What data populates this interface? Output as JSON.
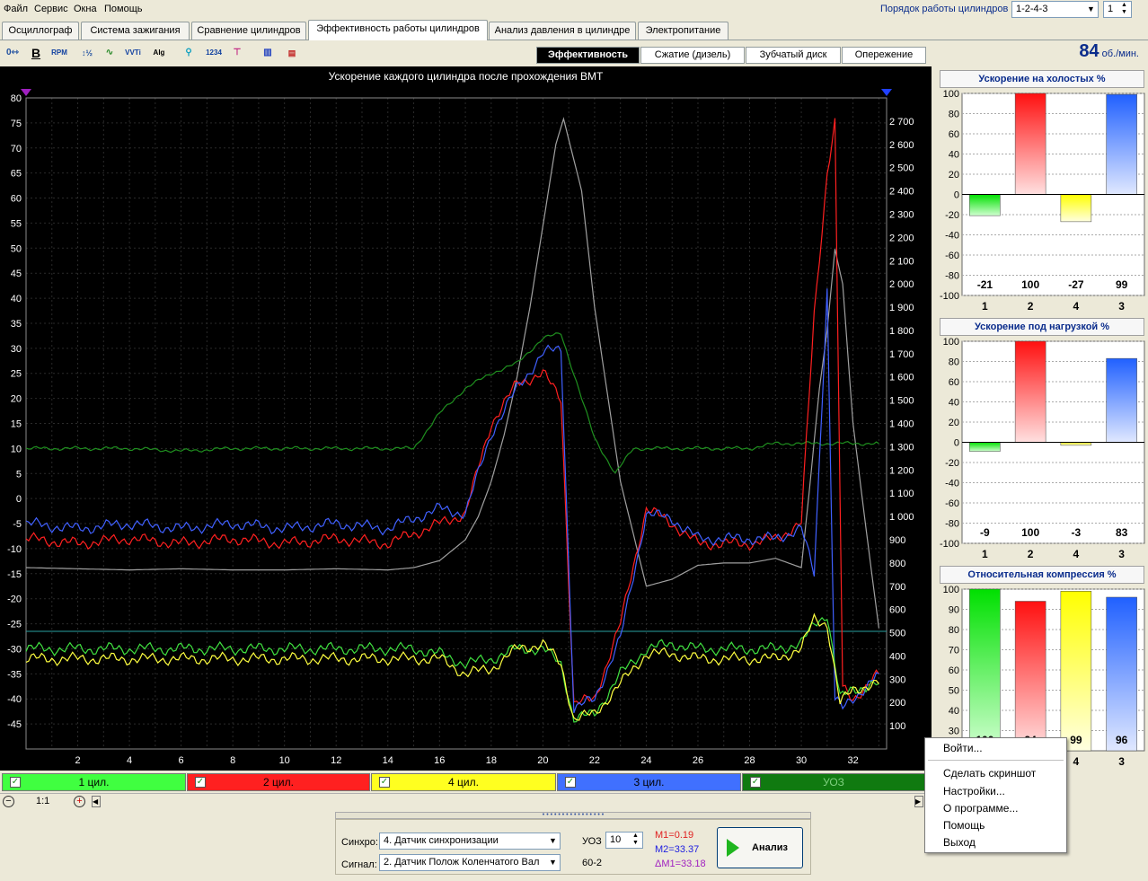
{
  "menu": [
    "Файл",
    "Сервис",
    "Окна",
    "Помощь"
  ],
  "cylinder_order": {
    "label": "Порядок работы цилиндров",
    "value": "1-2-4-3",
    "count_value": "1"
  },
  "tabs": [
    {
      "label": "Осциллограф",
      "active": false
    },
    {
      "label": "Система зажигания",
      "active": false
    },
    {
      "label": "Сравнение цилиндров",
      "active": false
    },
    {
      "label": "Эффективность работы цилиндров",
      "active": true
    },
    {
      "label": "Анализ давления в цилиндре",
      "active": false
    },
    {
      "label": "Электропитание",
      "active": false
    }
  ],
  "toolbar_icons": [
    "zero-offset-icon",
    "bold-icon",
    "rpm-icon",
    "scale-icon",
    "smooth-icon",
    "vvti-icon",
    "algorithm-icon",
    "sync-icon",
    "numbering-icon",
    "filter-icon",
    "bar-mode-icon",
    "settings-icon"
  ],
  "subtabs": [
    {
      "label": "Эффективность",
      "active": true
    },
    {
      "label": "Сжатие (дизель)",
      "active": false
    },
    {
      "label": "Зубчатый диск",
      "active": false
    },
    {
      "label": "Опережение",
      "active": false
    }
  ],
  "rpm": {
    "value": "84",
    "unit": "об./мин."
  },
  "chart": {
    "title": "Ускорение каждого цилиндра после прохождения ВМТ",
    "left_ticks": [
      "80",
      "75",
      "70",
      "65",
      "60",
      "55",
      "50",
      "45",
      "40",
      "35",
      "30",
      "25",
      "20",
      "15",
      "10",
      "5",
      "0",
      "-5",
      "-10",
      "-15",
      "-20",
      "-25",
      "-30",
      "-35",
      "-40",
      "-45"
    ],
    "right_ticks": [
      "2 700",
      "2 600",
      "2 500",
      "2 400",
      "2 300",
      "2 200",
      "2 100",
      "2 000",
      "1 900",
      "1 800",
      "1 700",
      "1 600",
      "1 500",
      "1 400",
      "1 300",
      "1 200",
      "1 100",
      "1 000",
      "900",
      "800",
      "700",
      "600",
      "500",
      "400",
      "300",
      "200",
      "100"
    ],
    "x_ticks": [
      "2",
      "4",
      "6",
      "8",
      "10",
      "12",
      "14",
      "16",
      "18",
      "20",
      "22",
      "24",
      "26",
      "28",
      "30",
      "32"
    ],
    "colors": {
      "cyl1": "#00c000",
      "cyl2": "#ff2020",
      "cyl4": "#ffff40",
      "cyl3": "#4060ff",
      "uoz": "#008000",
      "rpm": "#a0a0a0"
    }
  },
  "legend": [
    {
      "label": "1 цил.",
      "color": "#40ff40"
    },
    {
      "label": "2 цил.",
      "color": "#ff2020"
    },
    {
      "label": "4 цил.",
      "color": "#ffff20"
    },
    {
      "label": "3 цил.",
      "color": "#4070ff"
    },
    {
      "label": "УОЗ",
      "color": "#107a10"
    }
  ],
  "zoom": "1:1",
  "panels": [
    {
      "title": "Ускорение на холостых %",
      "ticks": [
        "100",
        "80",
        "60",
        "40",
        "20",
        "0",
        "-20",
        "-40",
        "-60",
        "-80",
        "-100"
      ],
      "categories": [
        "1",
        "2",
        "4",
        "3"
      ],
      "values": [
        -21,
        100,
        -27,
        99
      ],
      "labels": [
        "-21",
        "100",
        "-27",
        "99"
      ]
    },
    {
      "title": "Ускорение под нагрузкой %",
      "ticks": [
        "100",
        "80",
        "60",
        "40",
        "20",
        "0",
        "-20",
        "-40",
        "-60",
        "-80",
        "-100"
      ],
      "categories": [
        "1",
        "2",
        "4",
        "3"
      ],
      "values": [
        -9,
        100,
        -3,
        83
      ],
      "labels": [
        "-9",
        "100",
        "-3",
        "83"
      ]
    },
    {
      "title": "Относительная компрессия %",
      "ticks": [
        "100",
        "90",
        "80",
        "70",
        "60",
        "50",
        "40",
        "30"
      ],
      "categories": [
        "1",
        "2",
        "4",
        "3"
      ],
      "values": [
        100,
        94,
        99,
        96
      ],
      "labels": [
        "100",
        "94",
        "99",
        "96"
      ]
    }
  ],
  "bottom": {
    "sync_label": "Синхро:",
    "sync_value": "4.  Датчик синхронизации",
    "signal_label": "Сигнал:",
    "signal_value": "2.  Датчик Полож Коленчатого Вал",
    "uoz_label": "УОЗ",
    "uoz_value": "10",
    "teeth": "60-2",
    "m1": "M1=0.19",
    "m2": "M2=33.37",
    "dm": "ΔM1=33.18",
    "analyze": "Анализ"
  },
  "context_menu": [
    "Войти...",
    "Сделать скриншот",
    "Настройки...",
    "О программе...",
    "Помощь",
    "Выход"
  ],
  "chart_data": [
    {
      "type": "line",
      "title": "Ускорение каждого цилиндра после прохождения ВМТ",
      "xlim": [
        0,
        33.3
      ],
      "ylim": [
        -50,
        80
      ],
      "y2lim": [
        0,
        2800
      ],
      "grid": true,
      "series": [
        {
          "name": "2 цил.",
          "axis": "left",
          "x": [
            0,
            2,
            4,
            6,
            8,
            10,
            12,
            14,
            16,
            17,
            18,
            19,
            20,
            20.7,
            21.2,
            22,
            23,
            24,
            25,
            26,
            27,
            28,
            29,
            30,
            30.5,
            31,
            31.3,
            31.6,
            32,
            33
          ],
          "y": [
            -8,
            -9,
            -8,
            -9,
            -8,
            -9,
            -8,
            -9,
            -5,
            -3,
            15,
            23,
            25,
            20,
            -41,
            -40,
            -25,
            -2,
            -5,
            -9,
            -9,
            -9,
            -8,
            -5,
            37,
            65,
            75,
            -38,
            -40,
            -35
          ]
        },
        {
          "name": "3 цил.",
          "axis": "left",
          "x": [
            0,
            2,
            4,
            6,
            8,
            10,
            12,
            14,
            16,
            17,
            18,
            19,
            20,
            20.7,
            21.2,
            22,
            23,
            24,
            25,
            26,
            27,
            28,
            29,
            30,
            30.5,
            31,
            31.3,
            31.6,
            32,
            33
          ],
          "y": [
            -5,
            -6,
            -5,
            -6,
            -5,
            -6,
            -5,
            -6,
            -2,
            -3,
            13,
            22,
            29,
            30,
            -42,
            -40,
            -28,
            -3,
            -4,
            -8,
            -8,
            -8,
            -8,
            -6,
            -15,
            42,
            -40,
            -42,
            -40,
            -35
          ]
        },
        {
          "name": "1 цил.",
          "axis": "left",
          "x": [
            0,
            2,
            4,
            6,
            8,
            10,
            12,
            14,
            15,
            16,
            17,
            18,
            19,
            20,
            20.7,
            21.2,
            22,
            23,
            24,
            25,
            26,
            27,
            28,
            29,
            30,
            30.5,
            31,
            31.5,
            32,
            33
          ],
          "y": [
            -30,
            -30,
            -30,
            -30,
            -30,
            -30,
            -30,
            -30,
            -30,
            -31,
            -33,
            -32,
            -30,
            -30,
            -33,
            -44,
            -43,
            -35,
            -30,
            -29,
            -30,
            -30,
            -30,
            -30,
            -29,
            -25,
            -23,
            -40,
            -38,
            -37
          ]
        },
        {
          "name": "4 цил.",
          "axis": "left",
          "x": [
            0,
            2,
            4,
            6,
            8,
            10,
            12,
            14,
            15,
            16,
            17,
            18,
            19,
            20,
            20.7,
            21.2,
            22,
            23,
            24,
            25,
            26,
            27,
            28,
            29,
            30,
            30.5,
            31,
            31.5,
            32,
            33
          ],
          "y": [
            -32,
            -32,
            -32,
            -32,
            -32,
            -32,
            -32,
            -32,
            -32,
            -32,
            -35,
            -34,
            -30,
            -29,
            -33,
            -44,
            -43,
            -37,
            -31,
            -31,
            -32,
            -32,
            -32,
            -32,
            -30,
            -24,
            -25,
            -41,
            -38,
            -37
          ]
        },
        {
          "name": "УОЗ",
          "axis": "left",
          "x": [
            0,
            2,
            4,
            6,
            8,
            10,
            12,
            14,
            15,
            16,
            17,
            18,
            19,
            20,
            20.7,
            21.5,
            22,
            22.8,
            23.5,
            25,
            27,
            28,
            29,
            30,
            30.5,
            31,
            31.4,
            31.6,
            32,
            33
          ],
          "y": [
            10,
            10,
            10,
            9.5,
            10,
            10,
            10,
            10,
            10,
            17,
            22,
            25,
            27,
            32,
            33,
            20,
            12,
            5,
            10,
            10,
            10,
            10,
            11,
            11,
            11,
            11,
            11,
            11,
            11,
            11
          ]
        },
        {
          "name": "rpm",
          "axis": "right",
          "x": [
            0,
            2,
            4,
            6,
            8,
            10,
            12,
            14,
            15,
            16,
            17,
            17.5,
            18,
            18.5,
            19,
            19.5,
            20,
            20.5,
            20.8,
            21.5,
            22,
            23,
            24,
            25,
            26,
            27,
            28,
            29,
            30,
            30.3,
            30.7,
            31,
            31.3,
            31.6,
            32,
            32.5,
            33
          ],
          "y": [
            780,
            775,
            770,
            775,
            770,
            770,
            775,
            770,
            780,
            810,
            900,
            1000,
            1150,
            1350,
            1600,
            1900,
            2250,
            2600,
            2710,
            2400,
            1900,
            1150,
            700,
            730,
            790,
            800,
            800,
            820,
            780,
            1100,
            1550,
            1800,
            2150,
            2000,
            1400,
            950,
            520
          ]
        }
      ]
    },
    {
      "type": "bar",
      "title": "Ускорение на холостых %",
      "categories": [
        "1",
        "2",
        "4",
        "3"
      ],
      "values": [
        -21,
        100,
        -27,
        99
      ],
      "ylim": [
        -100,
        100
      ]
    },
    {
      "type": "bar",
      "title": "Ускорение под нагрузкой %",
      "categories": [
        "1",
        "2",
        "4",
        "3"
      ],
      "values": [
        -9,
        100,
        -3,
        83
      ],
      "ylim": [
        -100,
        100
      ]
    },
    {
      "type": "bar",
      "title": "Относительная компрессия %",
      "categories": [
        "1",
        "2",
        "4",
        "3"
      ],
      "values": [
        100,
        94,
        99,
        96
      ],
      "ylim": [
        20,
        100
      ]
    }
  ]
}
